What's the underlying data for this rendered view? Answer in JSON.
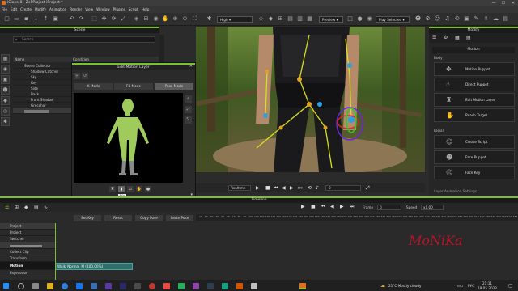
{
  "window": {
    "title": "iClone 8 - ZePProject iProject *",
    "min": "—",
    "max": "☐",
    "close": "✕"
  },
  "menu": [
    "File",
    "Edit",
    "Create",
    "Modify",
    "Animation",
    "Render",
    "View",
    "Window",
    "Plugins",
    "Script",
    "Help"
  ],
  "toolbar": {
    "quality": "High",
    "preview": "Preview",
    "play_mode": "Play Selected"
  },
  "scene": {
    "header": "Scene",
    "search_placeholder": "Search",
    "columns": [
      "Name",
      "Condition"
    ],
    "rows": [
      "Scene Collector",
      "Shadow Catcher",
      "Sky",
      "Key",
      "Side",
      "Back",
      "Front Shadow",
      "Grecchor"
    ]
  },
  "dialog": {
    "title": "Edit Motion Layer",
    "modes": [
      "IK Mode",
      "FK Mode",
      "Pose Mode"
    ],
    "buttons": [
      "Set Key",
      "Reset",
      "Copy Pose",
      "Paste Pose"
    ],
    "tooltip": "Bin"
  },
  "viewport": {
    "realtime": "Realtime",
    "frame": "0"
  },
  "modify": {
    "header": "Modify",
    "subheader": "Motion",
    "section_body": "Body",
    "section_facial": "Facial",
    "body_items": [
      "Motion Puppet",
      "Direct Puppet",
      "Edit Motion Layer",
      "Reach Target"
    ],
    "facial_items": [
      "Create Script",
      "Face Puppet",
      "Face Key"
    ],
    "more": "Layer Animation Settings"
  },
  "timeline": {
    "header": "Timeline",
    "frame_label": "Frame",
    "frame_value": "0",
    "speed_label": "Speed",
    "speed_value": "x1.00",
    "tracks": [
      "Project",
      "Project",
      "Switcher",
      "Collect Clip",
      "Transform",
      "Motion",
      "Expression"
    ],
    "clip": "Walk_Normal_M (100.00%)",
    "ticks": [
      "10",
      "20",
      "30",
      "40",
      "50",
      "60",
      "70",
      "80",
      "90",
      "100",
      "110",
      "120",
      "130",
      "140",
      "150",
      "160",
      "170",
      "180",
      "190",
      "200",
      "210",
      "220",
      "230",
      "240",
      "250",
      "260",
      "270",
      "280",
      "290",
      "300",
      "310",
      "320",
      "330",
      "340",
      "350",
      "360",
      "370",
      "380",
      "390",
      "400",
      "410",
      "420",
      "430",
      "440",
      "450",
      "460",
      "470",
      "480",
      "490",
      "500",
      "510",
      "520",
      "530",
      "540",
      "550",
      "560",
      "570",
      "580"
    ]
  },
  "watermark": "MoNiKa",
  "taskbar": {
    "weather": "21°C Mostly cloudy",
    "lang": "РУС",
    "time": "21:11",
    "date": "19.05.2023"
  },
  "colors": {
    "accent": "#7cc230",
    "clip": "#2e6f6a",
    "watermark": "#d0112b"
  }
}
